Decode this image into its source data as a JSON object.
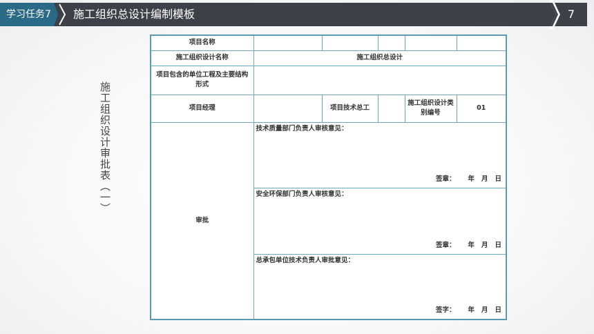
{
  "header": {
    "task_label": "学习任务7",
    "title": "施工组织总设计编制模板",
    "page_number": "7"
  },
  "side_title": "施工组织设计审批表（一）",
  "form": {
    "project_name_label": "项目名称",
    "design_name_label": "施工组织设计名称",
    "design_name_value": "施工组织总设计",
    "units_label": "项目包含的单位工程及主要结构形式",
    "manager_label": "项目经理",
    "tech_chief_label": "项目技术总工",
    "category_no_label": "施工组织设计类别编号",
    "category_no_value": "01",
    "approval_label": "审批",
    "sections": [
      {
        "title": "技术质量部门负责人审核意见：",
        "sign": "签章：",
        "year": "年",
        "month": "月",
        "day": "日"
      },
      {
        "title": "安全环保部门负责人审核意见：",
        "sign": "签章：",
        "year": "年",
        "month": "月",
        "day": "日"
      },
      {
        "title": "总承包单位技术负责人审批意见：",
        "sign": "签字：",
        "year": "年",
        "month": "月",
        "day": "日"
      }
    ]
  }
}
